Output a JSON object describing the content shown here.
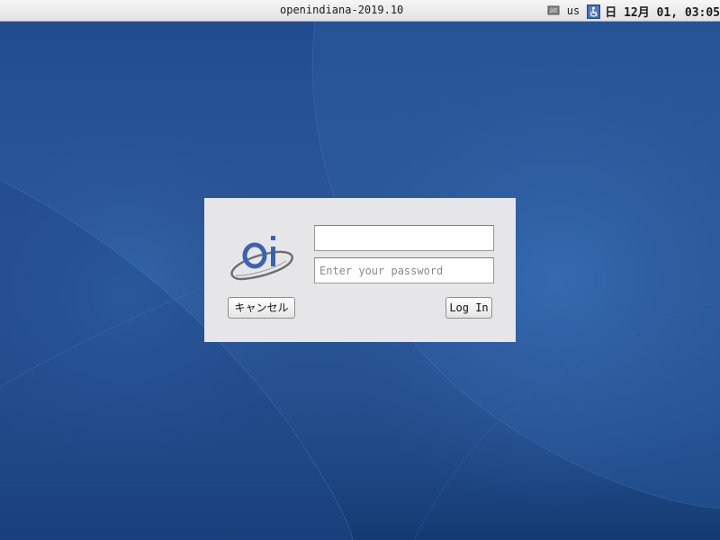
{
  "top_panel": {
    "hostname": "openindiana-2019.10",
    "keyboard_layout": "us",
    "clock": "日 12月 01, 03:05",
    "icons": [
      "display-icon",
      "accessibility-icon"
    ]
  },
  "login": {
    "username": {
      "value": "",
      "placeholder": ""
    },
    "password": {
      "value": "",
      "placeholder": "Enter your password"
    },
    "cancel_label": "キャンセル",
    "login_label": "Log In",
    "logo": "openindiana-logo"
  },
  "colors": {
    "wallpaper_base": "#2a5596",
    "wallpaper_dark": "#173d78",
    "wallpaper_light": "#3b6fb1",
    "panel_bg": "#ececec",
    "dialog_bg": "#e6e6e8",
    "logo_blue": "#3a63b0",
    "logo_gray": "#6a6a6a"
  }
}
